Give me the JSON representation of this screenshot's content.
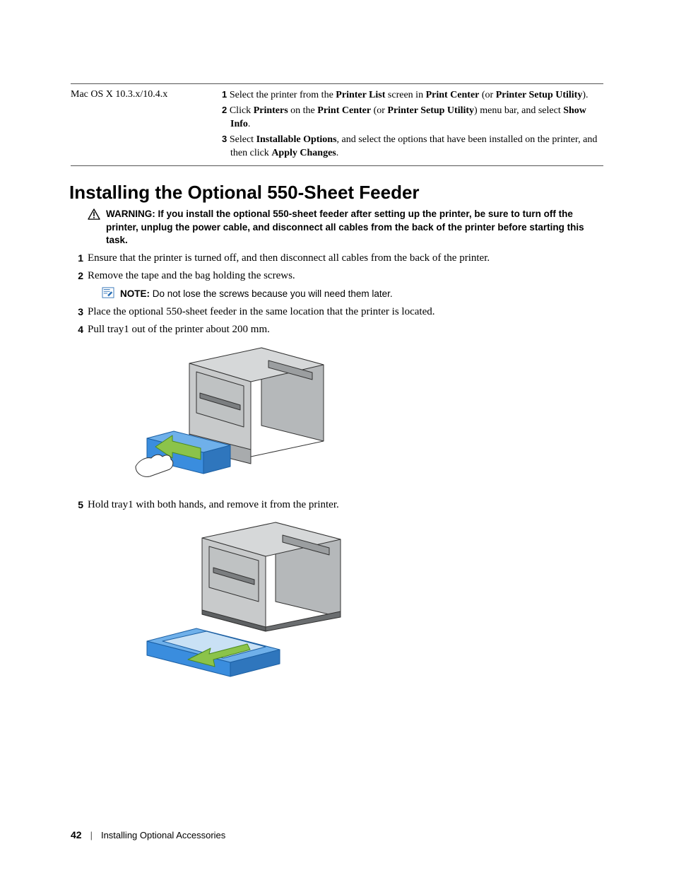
{
  "table": {
    "os": "Mac OS X 10.3.x/10.4.x",
    "steps": [
      {
        "num": "1",
        "parts": [
          {
            "t": "Select the printer from the ",
            "b": false
          },
          {
            "t": "Printer List",
            "b": true
          },
          {
            "t": " screen in ",
            "b": false
          },
          {
            "t": "Print Center",
            "b": true
          },
          {
            "t": " (or ",
            "b": false
          },
          {
            "t": "Printer Setup Utility",
            "b": true
          },
          {
            "t": ").",
            "b": false
          }
        ]
      },
      {
        "num": "2",
        "parts": [
          {
            "t": "Click ",
            "b": false
          },
          {
            "t": "Printers",
            "b": true
          },
          {
            "t": " on the ",
            "b": false
          },
          {
            "t": "Print Center",
            "b": true
          },
          {
            "t": " (or ",
            "b": false
          },
          {
            "t": "Printer Setup Utility",
            "b": true
          },
          {
            "t": ") menu bar, and select ",
            "b": false
          },
          {
            "t": "Show Info",
            "b": true
          },
          {
            "t": ".",
            "b": false
          }
        ]
      },
      {
        "num": "3",
        "parts": [
          {
            "t": "Select ",
            "b": false
          },
          {
            "t": "Installable Options",
            "b": true
          },
          {
            "t": ", and select the options that have been installed on the printer, and then click ",
            "b": false
          },
          {
            "t": "Apply Changes",
            "b": true
          },
          {
            "t": ".",
            "b": false
          }
        ]
      }
    ]
  },
  "heading": "Installing the Optional 550-Sheet Feeder",
  "warning": {
    "lead": "WARNING:",
    "text": " If you install the optional 550-sheet feeder after setting up the printer, be sure to turn off the printer, unplug the power cable, and disconnect all cables from the back of the printer before starting this task."
  },
  "steps": [
    "Ensure that the printer is turned off, and then disconnect all cables from the back of the printer.",
    "Remove the tape and the bag holding the screws.",
    "Place the optional 550-sheet feeder in the same location that the printer is located.",
    "Pull tray1 out of the printer about 200 mm.",
    "Hold tray1 with both hands, and remove it from the printer."
  ],
  "note": {
    "lead": "NOTE:",
    "text": " Do not lose the screws because you will need them later."
  },
  "footer": {
    "page": "42",
    "section": "Installing Optional Accessories"
  },
  "icons": {
    "warning": "warning-triangle-icon",
    "note": "note-pencil-icon"
  }
}
